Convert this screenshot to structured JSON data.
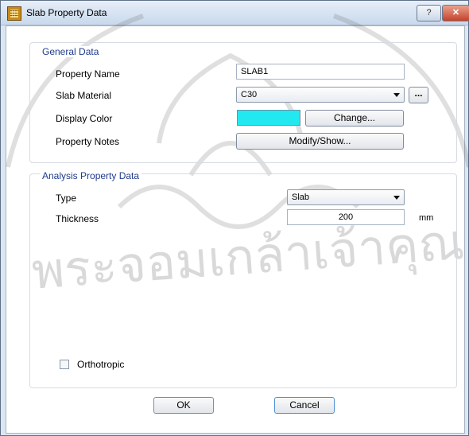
{
  "window": {
    "title": "Slab Property Data",
    "help_label": "?",
    "close_label": "✕"
  },
  "general": {
    "title": "General Data",
    "property_name_label": "Property Name",
    "property_name_value": "SLAB1",
    "slab_material_label": "Slab Material",
    "slab_material_value": "C30",
    "ellipsis_label": "...",
    "display_color_label": "Display Color",
    "display_color": "#22e8f0",
    "change_label": "Change...",
    "property_notes_label": "Property Notes",
    "modify_label": "Modify/Show..."
  },
  "analysis": {
    "title": "Analysis Property Data",
    "type_label": "Type",
    "type_value": "Slab",
    "thickness_label": "Thickness",
    "thickness_value": "200",
    "thickness_unit": "mm",
    "orthotropic_label": "Orthotropic",
    "orthotropic_checked": false
  },
  "buttons": {
    "ok": "OK",
    "cancel": "Cancel"
  }
}
